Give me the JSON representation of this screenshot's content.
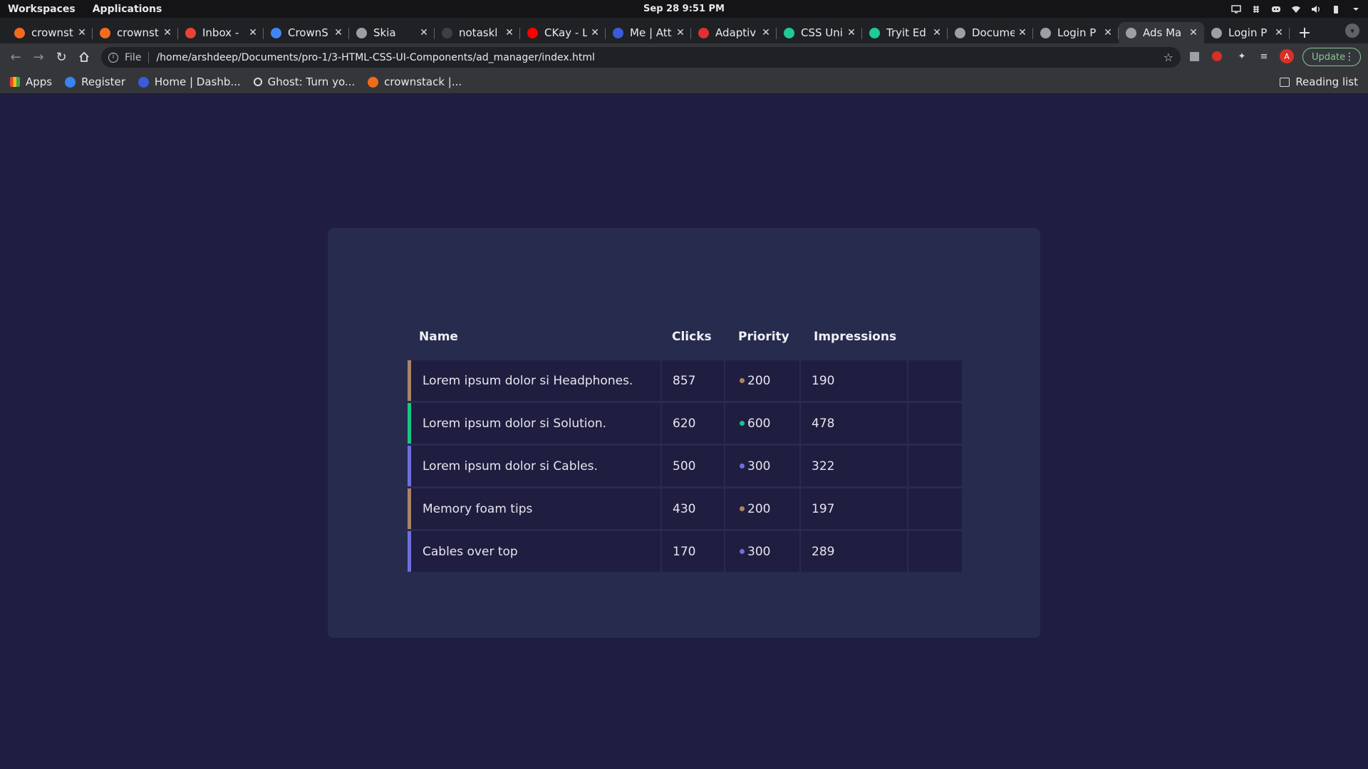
{
  "system_bar": {
    "workspaces": "Workspaces",
    "applications": "Applications",
    "clock": "Sep 28  9:51 PM"
  },
  "tabs": [
    {
      "title": "crownst",
      "color": "#f26b1d",
      "icon": "crownstack-icon"
    },
    {
      "title": "crownst",
      "color": "#f26b1d",
      "icon": "crownstack-icon"
    },
    {
      "title": "Inbox -",
      "color": "#ea4335",
      "icon": "gmail-icon"
    },
    {
      "title": "CrownS",
      "color": "#4285f4",
      "icon": "calendar-icon"
    },
    {
      "title": "Skia",
      "color": "#9aa0a6",
      "icon": "globe-icon"
    },
    {
      "title": "notaskl",
      "color": "#3c4043",
      "icon": "github-icon"
    },
    {
      "title": "CKay - L",
      "color": "#ff0000",
      "icon": "youtube-icon"
    },
    {
      "title": "Me | Att",
      "color": "#3b5bdb",
      "icon": "k-icon"
    },
    {
      "title": "Adaptiv",
      "color": "#e03131",
      "icon": "asterisk-icon"
    },
    {
      "title": "CSS Uni",
      "color": "#20c997",
      "icon": "w-icon"
    },
    {
      "title": "Tryit Ed",
      "color": "#20c997",
      "icon": "w-icon"
    },
    {
      "title": "Docume",
      "color": "#9aa0a6",
      "icon": "globe-icon"
    },
    {
      "title": "Login P",
      "color": "#9aa0a6",
      "icon": "globe-icon"
    },
    {
      "title": "Ads Ma",
      "color": "#9aa0a6",
      "icon": "globe-icon",
      "active": true
    },
    {
      "title": "Login P",
      "color": "#9aa0a6",
      "icon": "globe-icon"
    }
  ],
  "address_bar": {
    "protocol": "File",
    "url": "/home/arshdeep/Documents/pro-1/3-HTML-CSS-UI-Components/ad_manager/index.html"
  },
  "update_label": "Update",
  "bookmarks": [
    {
      "label": "Apps",
      "color": "#ea4335",
      "icon": "apps-grid-icon"
    },
    {
      "label": "Register",
      "color": "#3b82f6",
      "icon": "k-icon"
    },
    {
      "label": "Home | Dashb...",
      "color": "#3b5bdb",
      "icon": "k-icon"
    },
    {
      "label": "Ghost: Turn yo...",
      "color": "#dadce0",
      "icon": "ghost-icon"
    },
    {
      "label": "crownstack |...",
      "color": "#f26b1d",
      "icon": "crownstack-icon"
    }
  ],
  "reading_list": "Reading list",
  "table": {
    "headers": {
      "name": "Name",
      "clicks": "Clicks",
      "priority": "Priority",
      "impressions": "Impressions"
    },
    "rows": [
      {
        "name": "Lorem ipsum dolor si Headphones.",
        "clicks": "857",
        "priority": "200",
        "impressions": "190",
        "accent": "#ab8466"
      },
      {
        "name": "Lorem ipsum dolor si Solution.",
        "clicks": "620",
        "priority": "600",
        "impressions": "478",
        "accent": "#16c784"
      },
      {
        "name": "Lorem ipsum dolor si Cables.",
        "clicks": "500",
        "priority": "300",
        "impressions": "322",
        "accent": "#6d6fde"
      },
      {
        "name": "Memory foam tips",
        "clicks": "430",
        "priority": "200",
        "impressions": "197",
        "accent": "#ab8466"
      },
      {
        "name": "Cables over top",
        "clicks": "170",
        "priority": "300",
        "impressions": "289",
        "accent": "#6d6fde"
      }
    ]
  },
  "colors": {
    "page_bg": "#1f1e40",
    "card_bg": "#272b4e",
    "row_bg": "#1f1e40"
  }
}
